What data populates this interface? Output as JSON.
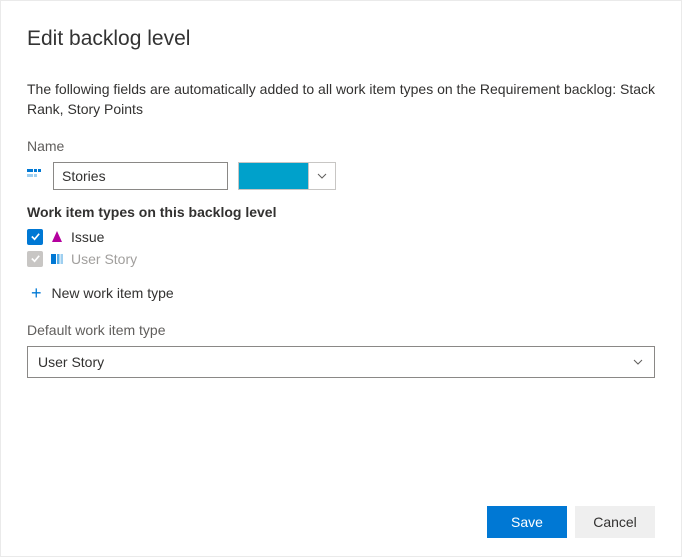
{
  "title": "Edit backlog level",
  "description": "The following fields are automatically added to all work item types on the Requirement backlog: Stack Rank, Story Points",
  "nameLabel": "Name",
  "nameValue": "Stories",
  "colorValue": "#00a1cb",
  "witSectionLabel": "Work item types on this backlog level",
  "workItemTypes": [
    {
      "name": "Issue",
      "checked": true,
      "enabled": true,
      "iconColor": "#b4009e"
    },
    {
      "name": "User Story",
      "checked": true,
      "enabled": false,
      "iconColor": "#0078d4"
    }
  ],
  "addNewLabel": "New work item type",
  "defaultLabel": "Default work item type",
  "defaultValue": "User Story",
  "buttons": {
    "save": "Save",
    "cancel": "Cancel"
  }
}
